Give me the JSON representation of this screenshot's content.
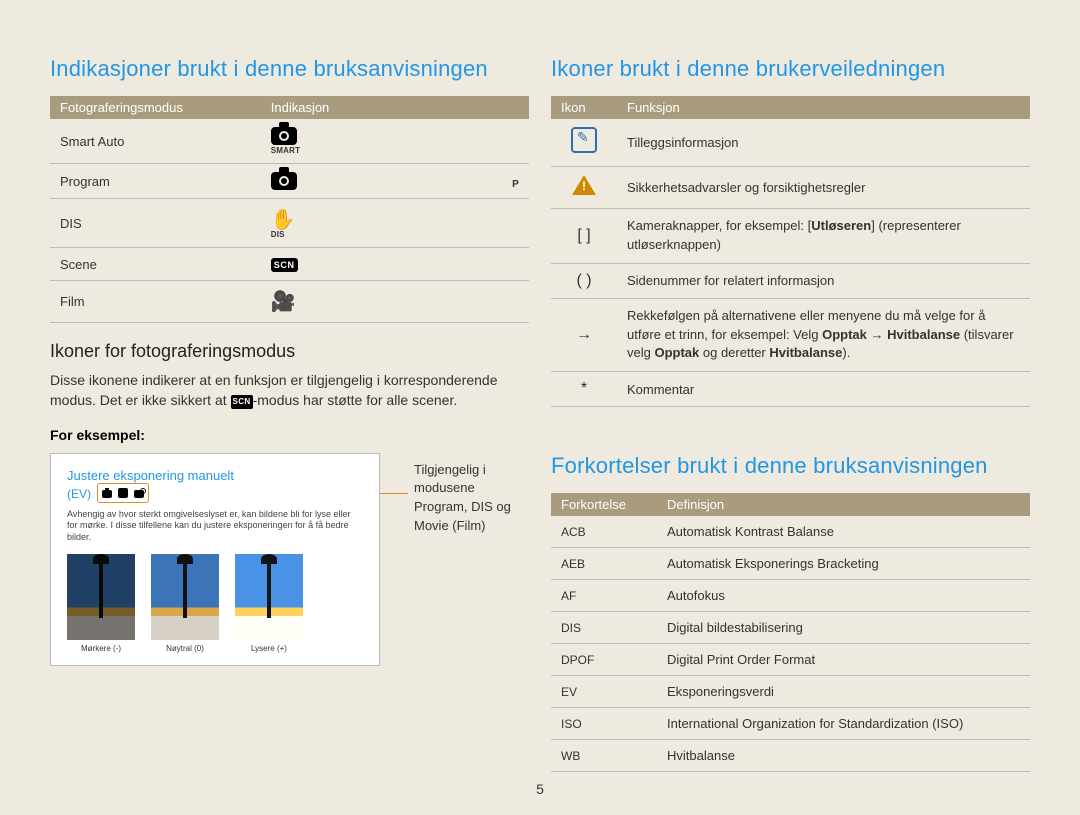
{
  "page_number": "5",
  "left": {
    "heading": "Indikasjoner brukt i denne bruksanvisningen",
    "modes_table": {
      "headers": [
        "Fotograferingsmodus",
        "Indikasjon"
      ],
      "rows": [
        {
          "mode": "Smart Auto",
          "icon_name": "camera-smart-icon",
          "icon_sub": "SMART"
        },
        {
          "mode": "Program",
          "icon_name": "camera-p-icon",
          "icon_sub": "P"
        },
        {
          "mode": "DIS",
          "icon_name": "hand-dis-icon",
          "icon_sub": "DIS"
        },
        {
          "mode": "Scene",
          "icon_name": "scn-icon",
          "icon_sub": "SCN"
        },
        {
          "mode": "Film",
          "icon_name": "film-icon",
          "icon_sub": ""
        }
      ]
    },
    "sub_heading": "Ikoner for fotograferingsmodus",
    "sub_text_a": "Disse ikonene indikerer at en funksjon er tilgjengelig i korresponderende modus. Det er ikke sikkert at ",
    "sub_text_scn": "SCN",
    "sub_text_b": "-modus har støtte for alle scener.",
    "example_label": "For eksempel:",
    "example": {
      "title": "Justere eksponering manuelt",
      "ev": "(EV)",
      "desc": "Avhengig av hvor sterkt omgivelseslyset er, kan bildene bli for lyse eller for mørke. I disse tilfellene kan du justere eksponeringen for å få bedre bilder.",
      "thumbs": [
        {
          "label": "Mørkere (-)",
          "variant": "dark"
        },
        {
          "label": "Nøytral (0)",
          "variant": "normal"
        },
        {
          "label": "Lysere (+)",
          "variant": "light"
        }
      ],
      "callout": "Tilgjengelig i modusene Program, DIS og Movie (Film)"
    }
  },
  "right": {
    "icons_heading": "Ikoner brukt i denne brukerveiledningen",
    "icons_table": {
      "headers": [
        "Ikon",
        "Funksjon"
      ],
      "rows": [
        {
          "icon_name": "info-square-icon",
          "glyph": "",
          "func": "Tilleggsinformasjon"
        },
        {
          "icon_name": "warning-triangle-icon",
          "glyph": "",
          "func": "Sikkerhetsadvarsler og forsiktighetsregler"
        },
        {
          "icon_name": "square-brackets-icon",
          "glyph": "[  ]",
          "func_pre": "Kameraknapper, for eksempel: [",
          "func_bold": "Utløseren",
          "func_post": "] (representerer utløserknappen)"
        },
        {
          "icon_name": "parentheses-icon",
          "glyph": "(  )",
          "func": "Sidenummer for relatert informasjon"
        },
        {
          "icon_name": "arrow-right-icon",
          "glyph": "→",
          "func_long_a": "Rekkefølgen på alternativene eller menyene du må velge for å utføre et trinn, for eksempel: Velg ",
          "func_bold1": "Opptak",
          "func_arrow": " → ",
          "func_bold2": "Hvitbalanse",
          "func_long_b": " (tilsvarer velg ",
          "func_bold3": "Opptak",
          "func_long_c": " og deretter ",
          "func_bold4": "Hvitbalanse",
          "func_long_d": ")."
        },
        {
          "icon_name": "asterisk-icon",
          "glyph": "*",
          "func": "Kommentar"
        }
      ]
    },
    "abbr_heading": "Forkortelser brukt i denne bruksanvisningen",
    "abbr_table": {
      "headers": [
        "Forkortelse",
        "Definisjon"
      ],
      "rows": [
        {
          "abbr": "ACB",
          "def": "Automatisk Kontrast Balanse"
        },
        {
          "abbr": "AEB",
          "def": "Automatisk Eksponerings Bracketing"
        },
        {
          "abbr": "AF",
          "def": "Autofokus"
        },
        {
          "abbr": "DIS",
          "def": "Digital bildestabilisering"
        },
        {
          "abbr": "DPOF",
          "def": "Digital Print Order Format"
        },
        {
          "abbr": "EV",
          "def": "Eksponeringsverdi"
        },
        {
          "abbr": "ISO",
          "def": "International Organization for Standardization (ISO)"
        },
        {
          "abbr": "WB",
          "def": "Hvitbalanse"
        }
      ]
    }
  }
}
